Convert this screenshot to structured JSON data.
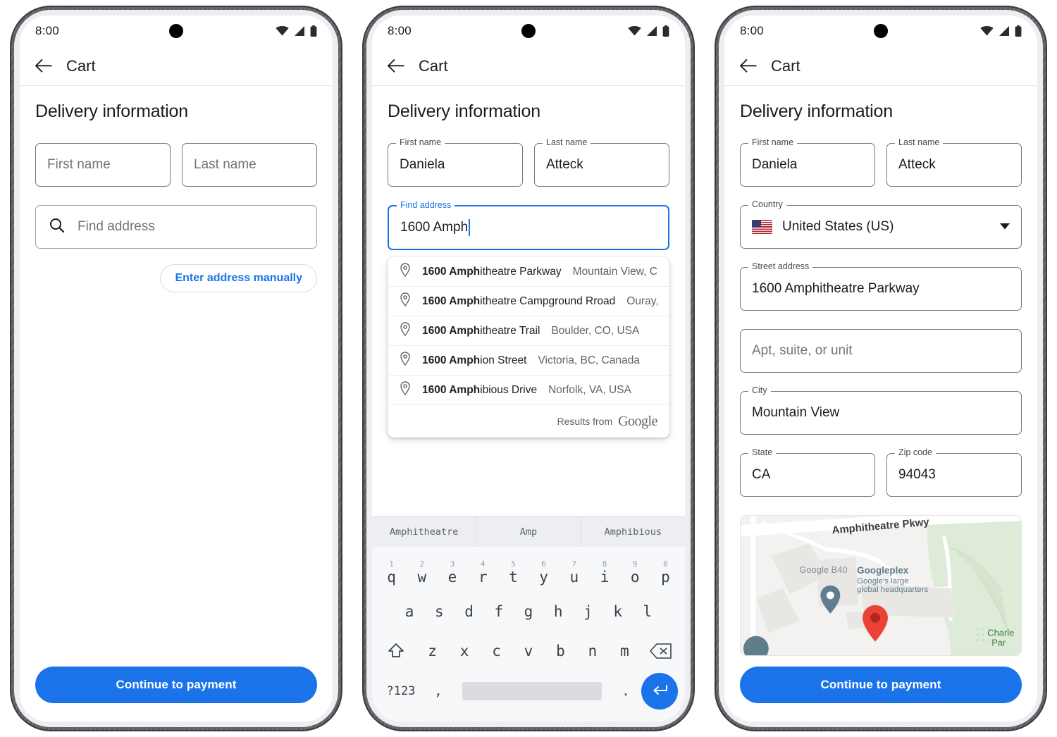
{
  "status_bar": {
    "time": "8:00",
    "icons": [
      "wifi-icon",
      "cell-signal-icon",
      "battery-icon"
    ]
  },
  "app_bar": {
    "title": "Cart",
    "back_icon": "back-arrow-icon"
  },
  "section": {
    "title": "Delivery information"
  },
  "colors": {
    "accent": "#1a73e8",
    "outline": "#79747e",
    "placeholder": "#70757a",
    "map_pin": "#ea4335"
  },
  "cta": {
    "label": "Continue to payment"
  },
  "phone1": {
    "first_name": {
      "label": "First name",
      "placeholder": "First name",
      "value": ""
    },
    "last_name": {
      "label": "Last name",
      "placeholder": "Last name",
      "value": ""
    },
    "search": {
      "placeholder": "Find address",
      "icon": "search-icon",
      "value": ""
    },
    "manual_chip": {
      "label": "Enter address manually"
    }
  },
  "phone2": {
    "first_name": {
      "label": "First name",
      "value": "Daniela"
    },
    "last_name": {
      "label": "Last name",
      "value": "Atteck"
    },
    "find_address": {
      "label": "Find address",
      "value": "1600 Amph",
      "focused": true
    },
    "suggestions": [
      {
        "bold": "1600 Amph",
        "rest": "itheatre Parkway",
        "sub": "Mountain View, C..."
      },
      {
        "bold": "1600 Amph",
        "rest": "itheatre Campground Rroad",
        "sub": "Ouray, ..."
      },
      {
        "bold": "1600 Amph",
        "rest": "itheatre Trail",
        "sub": "Boulder, CO, USA"
      },
      {
        "bold": "1600 Amph",
        "rest": "ion Street",
        "sub": "Victoria, BC, Canada"
      },
      {
        "bold": "1600 Amph",
        "rest": "ibious Drive",
        "sub": "Norfolk, VA, USA"
      }
    ],
    "suggestions_footer": {
      "text": "Results from",
      "brand": "Google"
    },
    "keyboard": {
      "suggestions": [
        "Amphitheatre",
        "Amp",
        "Amphibious"
      ],
      "row1": [
        {
          "num": "1",
          "key": "q"
        },
        {
          "num": "2",
          "key": "w"
        },
        {
          "num": "3",
          "key": "e"
        },
        {
          "num": "4",
          "key": "r"
        },
        {
          "num": "5",
          "key": "t"
        },
        {
          "num": "6",
          "key": "y"
        },
        {
          "num": "7",
          "key": "u"
        },
        {
          "num": "8",
          "key": "i"
        },
        {
          "num": "9",
          "key": "o"
        },
        {
          "num": "0",
          "key": "p"
        }
      ],
      "row2": [
        "a",
        "s",
        "d",
        "f",
        "g",
        "h",
        "j",
        "k",
        "l"
      ],
      "row3": [
        "z",
        "x",
        "c",
        "v",
        "b",
        "n",
        "m"
      ],
      "shift_icon": "shift-key-icon",
      "backspace_icon": "backspace-key-icon",
      "symbols_key": "?123",
      "comma_key": ",",
      "period_key": ".",
      "enter_icon": "enter-key-icon"
    }
  },
  "phone3": {
    "first_name": {
      "label": "First name",
      "value": "Daniela"
    },
    "last_name": {
      "label": "Last name",
      "value": "Atteck"
    },
    "country": {
      "label": "Country",
      "value": "United States (US)",
      "flag": "us-flag-icon",
      "arrow": "dropdown-arrow-icon"
    },
    "street": {
      "label": "Street address",
      "value": "1600 Amphitheatre Parkway"
    },
    "apt": {
      "label": "",
      "placeholder": "Apt, suite, or unit",
      "value": ""
    },
    "city": {
      "label": "City",
      "value": "Mountain View"
    },
    "state": {
      "label": "State",
      "value": "CA"
    },
    "zip": {
      "label": "Zip code",
      "value": "94043"
    },
    "map": {
      "road_label": "Amphitheatre Pkwy",
      "poi_b40": "Google B40",
      "poi_title": "Googleplex",
      "poi_sub_line1": "Google's large",
      "poi_sub_line2": "global headquarters",
      "park_label_line1": "Charle",
      "park_label_line2": "Par",
      "pin_icon": "map-pin-icon",
      "poi_pin_icon": "poi-pin-icon"
    }
  }
}
